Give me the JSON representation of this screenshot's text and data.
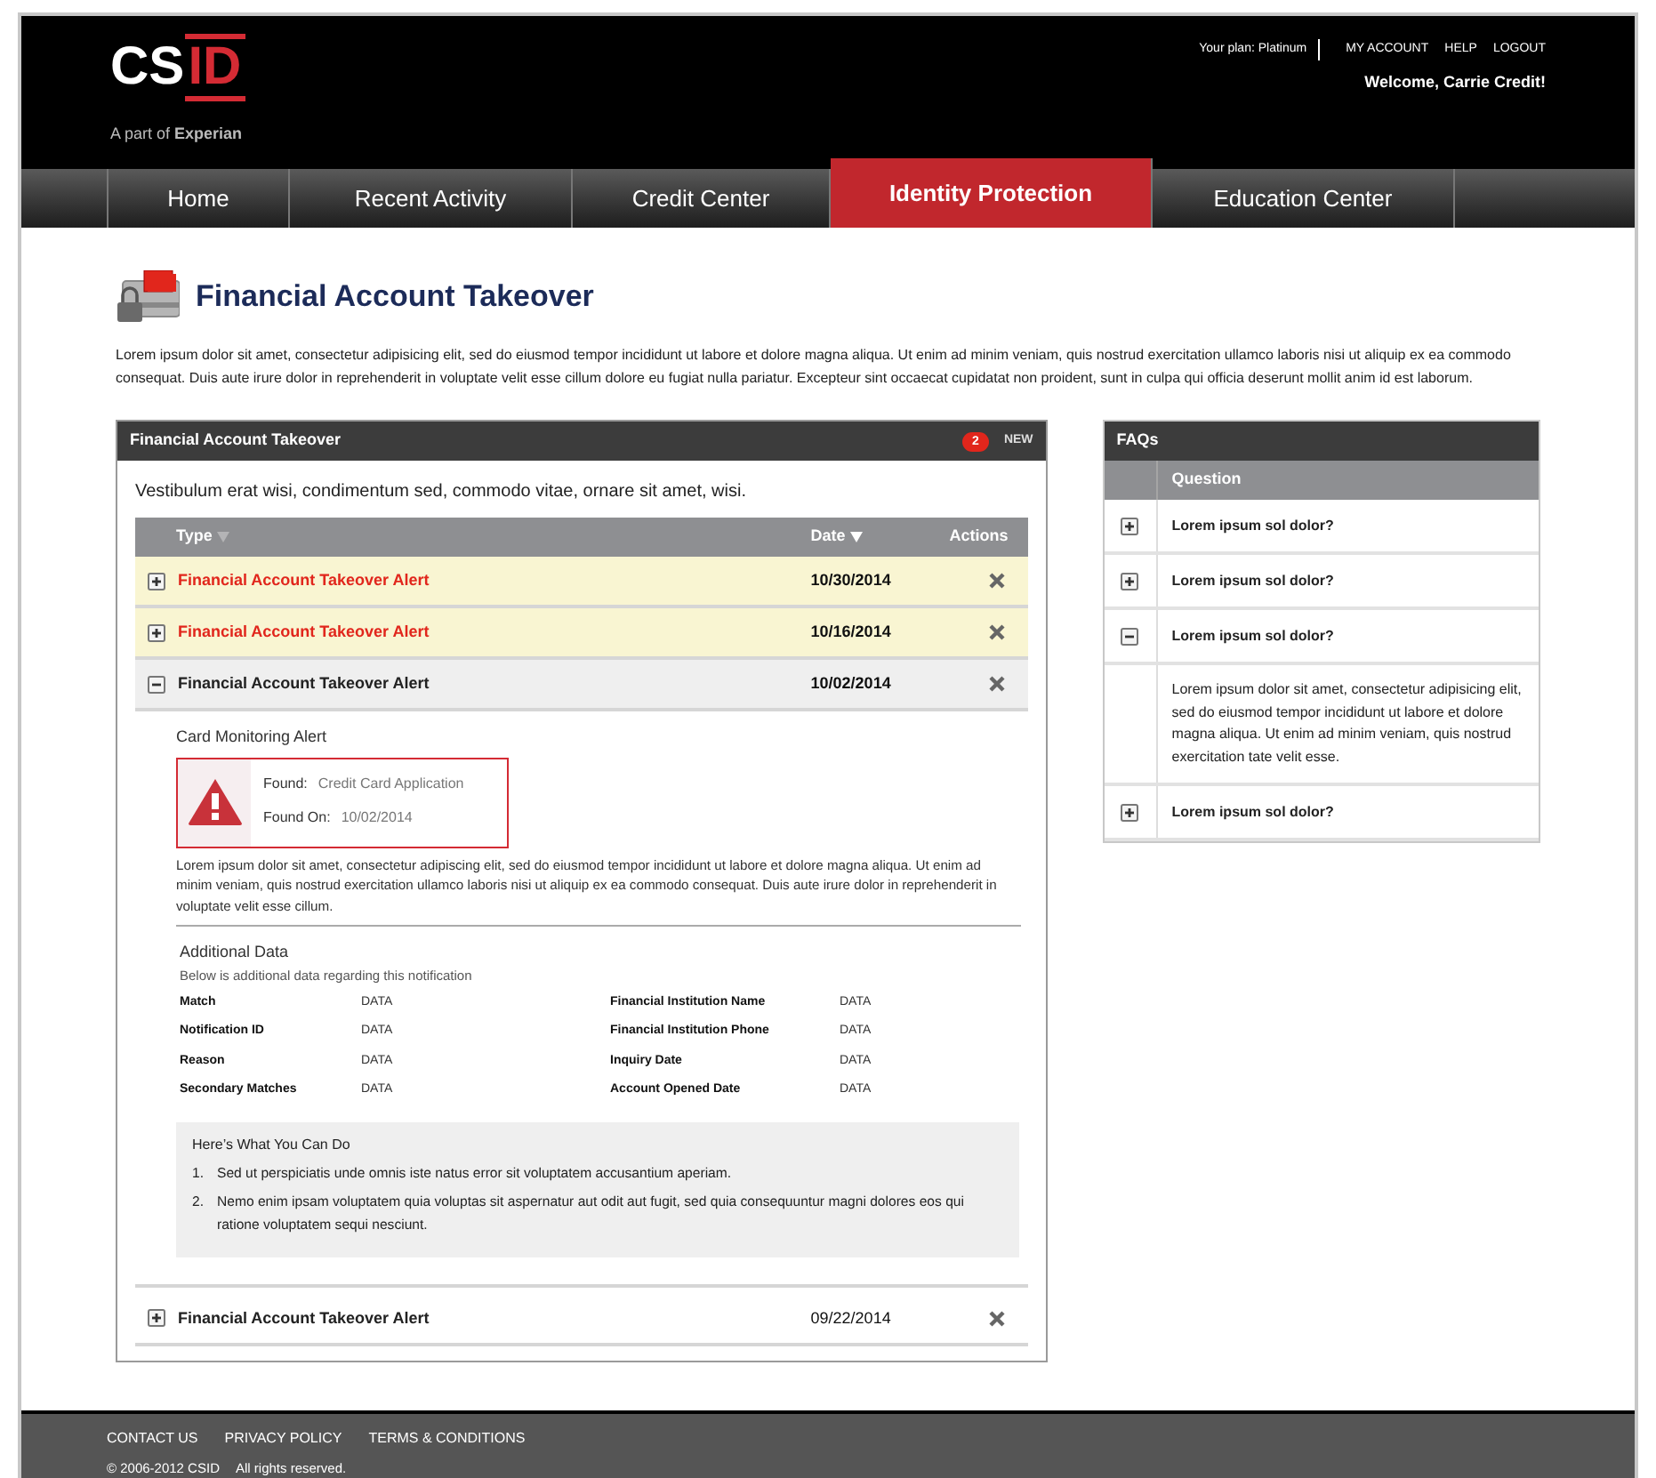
{
  "header": {
    "logo": {
      "plain": "CS",
      "accent": "ID",
      "tagline": "A part of **Experian**"
    },
    "plan": "Your plan: Platinum",
    "links": [
      "MY ACCOUNT",
      "HELP",
      "LOGOUT"
    ],
    "welcome": "Welcome, Carrie Credit!"
  },
  "nav": [
    {
      "label": "Home",
      "selected": false
    },
    {
      "label": "Recent Activity",
      "selected": false
    },
    {
      "label": "Credit Center",
      "selected": false
    },
    {
      "label": "Identity Protection",
      "selected": true
    },
    {
      "label": "Education Center",
      "selected": false
    }
  ],
  "page": {
    "title": "Financial Account Takeover",
    "intro": "Lorem ipsum dolor sit amet, consectetur adipisicing elit, sed do eiusmod tempor incididunt ut labore et dolore magna aliqua. Ut enim ad minim veniam, quis nostrud exercitation ullamco laboris nisi ut aliquip ex ea commodo consequat. Duis aute irure dolor in reprehenderit in voluptate velit esse cillum dolore eu fugiat nulla pariatur. Excepteur sint occaecat cupidatat non proident, sunt in culpa qui officia deserunt mollit anim id est laborum."
  },
  "alerts_panel": {
    "title": "Financial Account Takeover",
    "badge": "2",
    "badge_label": "NEW",
    "subtitle": "Vestibulum erat wisi, condimentum sed, commodo vitae, ornare sit amet, wisi.",
    "columns": [
      {
        "label": "Type",
        "sorted": false
      },
      {
        "label": "Date",
        "sorted": true
      },
      {
        "label": "Actions"
      }
    ],
    "rows": [
      {
        "type": "Financial Account Takeover Alert",
        "date": "10/30/2014",
        "unread": true,
        "expanded": false
      },
      {
        "type": "Financial Account Takeover Alert",
        "date": "10/16/2014",
        "unread": true,
        "expanded": false
      },
      {
        "type": "Financial Account Takeover Alert",
        "date": "10/02/2014",
        "unread": false,
        "expanded": true,
        "detail": {
          "heading": "Card Monitoring Alert",
          "found_label": "Found:",
          "found": "Credit Card Application",
          "found_on_label": "Found On:",
          "found_on": "10/02/2014",
          "description": "Lorem ipsum dolor sit amet, consectetur adipiscing elit, sed do eiusmod tempor incididunt ut labore et dolore magna aliqua. Ut enim ad minim veniam, quis nostrud exercitation ullamco laboris nisi ut aliquip ex ea commodo consequat. Duis aute irure dolor in reprehenderit in voluptate velit esse cillum.",
          "additional_title": "Additional Data",
          "additional_subtitle": "Below is additional data regarding this notification",
          "fields": [
            {
              "label": "Match",
              "value": "DATA"
            },
            {
              "label": "Financial Institution Name",
              "value": "DATA"
            },
            {
              "label": "Notification ID",
              "value": "DATA"
            },
            {
              "label": "Financial Institution Phone",
              "value": "DATA"
            },
            {
              "label": "Reason",
              "value": "DATA"
            },
            {
              "label": "Inquiry Date",
              "value": "DATA"
            },
            {
              "label": "Secondary Matches",
              "value": "DATA"
            },
            {
              "label": "Account Opened Date",
              "value": "DATA"
            }
          ],
          "actions_title": "Here’s What You Can Do",
          "actions": [
            {
              "number": "1.",
              "text": "Sed ut perspiciatis unde omnis iste natus error sit voluptatem accusantium aperiam."
            },
            {
              "number": "2.",
              "text": "Nemo enim ipsam voluptatem quia voluptas sit aspernatur aut odit aut fugit, sed quia consequuntur magni dolores eos qui ratione voluptatem sequi nesciunt."
            }
          ]
        }
      },
      {
        "type": "Financial Account Takeover Alert",
        "date": "09/22/2014",
        "unread": false,
        "expanded": false
      }
    ]
  },
  "faqs": {
    "title": "FAQs",
    "column": "Question",
    "items": [
      {
        "question": "Lorem ipsum sol dolor?",
        "expanded": false
      },
      {
        "question": "Lorem ipsum sol dolor?",
        "expanded": false
      },
      {
        "question": "Lorem ipsum sol dolor?",
        "expanded": true,
        "answer": "Lorem ipsum dolor sit amet, consectetur adipisicing elit, sed do eiusmod tempor incididunt ut labore et dolore magna aliqua. Ut enim ad minim veniam, quis nostrud exercitation tate velit esse."
      },
      {
        "question": "Lorem ipsum sol dolor?",
        "expanded": false
      }
    ]
  },
  "footer": {
    "links": [
      "CONTACT US",
      "PRIVACY POLICY",
      "TERMS & CONDITIONS"
    ],
    "copyright": "© 2006-2012 CSID",
    "rights": "All rights reserved."
  }
}
